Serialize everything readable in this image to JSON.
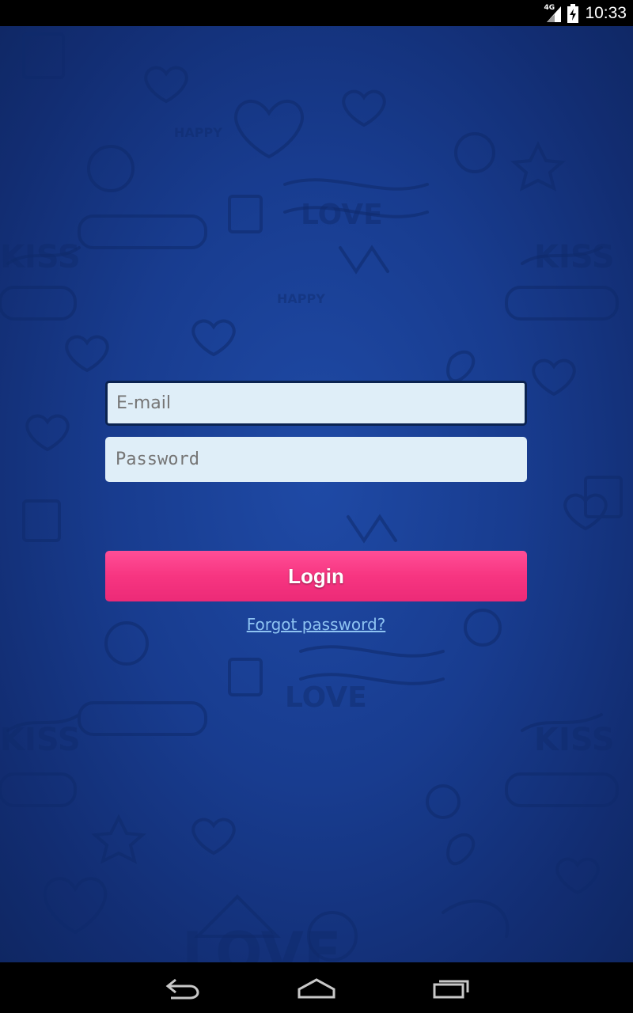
{
  "status_bar": {
    "network_label": "4G",
    "time": "10:33",
    "icons": [
      "signal-icon",
      "battery-icon"
    ]
  },
  "login": {
    "email_placeholder": "E-mail",
    "password_placeholder": "Password",
    "login_label": "Login",
    "forgot_label": "Forgot password?"
  },
  "nav_bar": {
    "icons": [
      "back-icon",
      "home-icon",
      "recents-icon"
    ]
  },
  "colors": {
    "background": "#183c8f",
    "field": "#dfeef8",
    "accent": "#f73581",
    "link": "#8ec3f2"
  }
}
